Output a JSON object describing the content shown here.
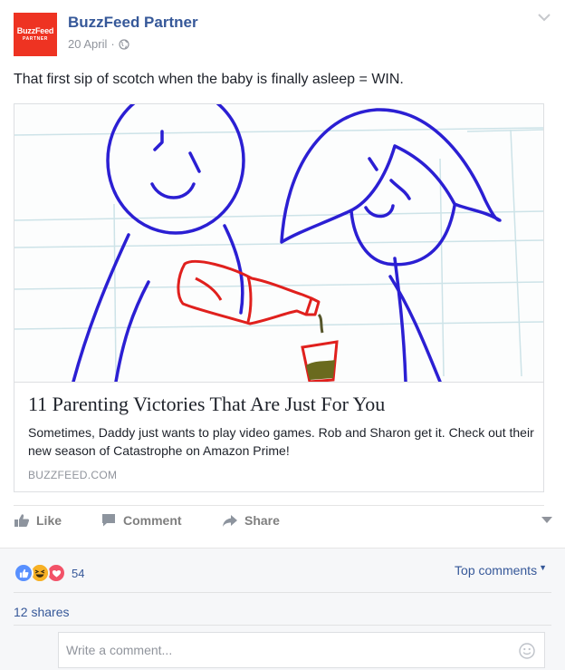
{
  "post": {
    "page_name": "BuzzFeed Partner",
    "avatar_line1": "BuzzFeed",
    "avatar_line2": "PARTNER",
    "date": "20 April",
    "separator": "·",
    "text": "That first sip of scotch when the baby is finally asleep = WIN."
  },
  "link": {
    "title": "11 Parenting Victories That Are Just For You",
    "description": "Sometimes, Daddy just wants to play video games. Rob and Sharon get it. Check out their new season of Catastrophe on Amazon Prime!",
    "domain": "BUZZFEED.COM"
  },
  "actions": {
    "like": "Like",
    "comment": "Comment",
    "share": "Share"
  },
  "feedback": {
    "reaction_count": "54",
    "top_comments": "Top comments",
    "shares": "12 shares",
    "comment_placeholder": "Write a comment..."
  },
  "colors": {
    "brand_red": "#ee3322",
    "link_blue": "#365899",
    "like_blue": "#5890ff",
    "haha_yellow": "#f7b125",
    "love_red": "#f25268"
  }
}
